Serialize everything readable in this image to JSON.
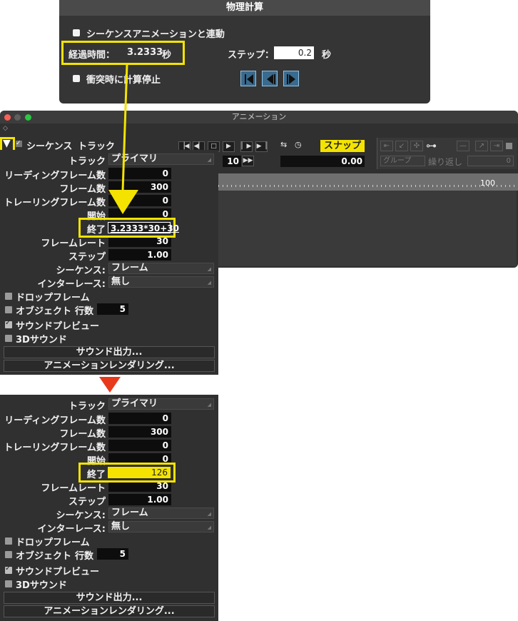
{
  "physics_window": {
    "title": "物理計算",
    "sync_label": "シーケンスアニメーションと連動",
    "elapsed_label": "経過時間：",
    "elapsed_value": "3.2333",
    "elapsed_unit": "秒",
    "step_label": "ステップ：",
    "step_value": "0.2",
    "step_unit": "秒",
    "collision_label": "衝突時に計算停止"
  },
  "animation_window": {
    "title": "アニメーション",
    "sequence_label": "シーケンス",
    "track_label_header": "トラック",
    "frame_step_value": "10",
    "time_value": "0.00",
    "snap_label": "スナップ",
    "group_label": "グループ",
    "repeat_label": "繰り返し",
    "repeat_value": "0",
    "ruler_mark": "100"
  },
  "panel_before": {
    "track_label": "トラック",
    "track_value": "プライマリ",
    "leading_label": "リーディングフレーム数",
    "leading_value": "0",
    "frames_label": "フレーム数",
    "frames_value": "300",
    "trailing_label": "トレーリングフレーム数",
    "trailing_value": "0",
    "start_label": "開始",
    "start_value": "0",
    "end_label": "終了",
    "end_value": "3.2333*30+30",
    "framerate_label": "フレームレート",
    "framerate_value": "30",
    "step_label": "ステップ",
    "step_value": "1.00",
    "sequence_label": "シーケンス:",
    "sequence_value": "フレーム",
    "interlace_label": "インターレース:",
    "interlace_value": "無し",
    "drop_frame_label": "ドロップフレーム",
    "object_label": "オブジェクト",
    "rows_label": "行数",
    "rows_value": "5",
    "sound_preview_label": "サウンドプレビュー",
    "sound3d_label": "3Dサウンド",
    "sound_output_label": "サウンド出力...",
    "render_label": "アニメーションレンダリング..."
  },
  "panel_after": {
    "track_label": "トラック",
    "track_value": "プライマリ",
    "leading_label": "リーディングフレーム数",
    "leading_value": "0",
    "frames_label": "フレーム数",
    "frames_value": "300",
    "trailing_label": "トレーリングフレーム数",
    "trailing_value": "0",
    "start_label": "開始",
    "start_value": "0",
    "end_label": "終了",
    "end_value": "126",
    "framerate_label": "フレームレート",
    "framerate_value": "30",
    "step_label": "ステップ",
    "step_value": "1.00",
    "sequence_label": "シーケンス:",
    "sequence_value": "フレーム",
    "interlace_label": "インターレース:",
    "interlace_value": "無し",
    "drop_frame_label": "ドロップフレーム",
    "object_label": "オブジェクト",
    "rows_label": "行数",
    "rows_value": "5",
    "sound_preview_label": "サウンドプレビュー",
    "sound3d_label": "3Dサウンド",
    "sound_output_label": "サウンド出力...",
    "render_label": "アニメーションレンダリング..."
  },
  "colors": {
    "highlight": "#f4e300",
    "arrow_red": "#e8391d",
    "panel_bg": "#303030"
  }
}
